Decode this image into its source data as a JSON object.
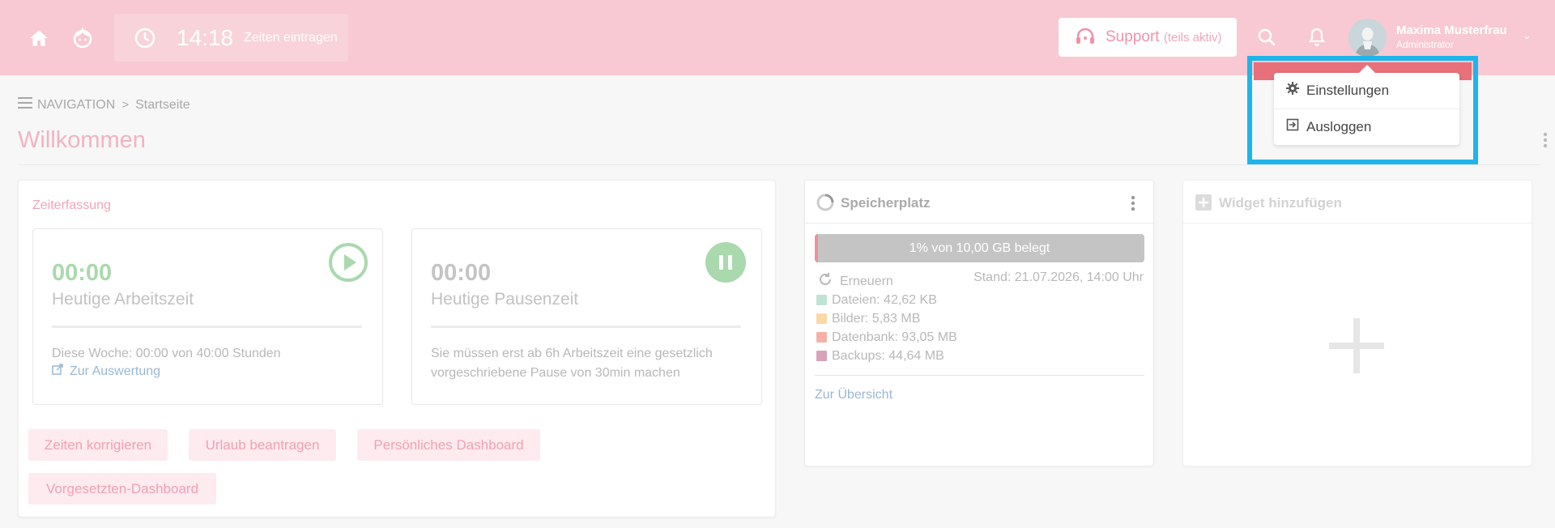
{
  "header": {
    "time": "14:18",
    "time_link": "Zeiten eintragen",
    "support_label": "Support",
    "support_sub": "(teils aktiv)",
    "user_name": "Maxima Musterfrau",
    "user_role": "Administrator",
    "bg_color": "#f8c9d2"
  },
  "breadcrumb": {
    "nav": "NAVIGATION",
    "separator": ">",
    "current": "Startseite"
  },
  "page_title": "Willkommen",
  "zeiterfassung": {
    "title": "Zeiterfassung",
    "work": {
      "time": "00:00",
      "label": "Heutige Arbeitszeit",
      "week_text": "Diese Woche: 00:00 von 40:00 Stunden",
      "link": "Zur Auswertung"
    },
    "pause": {
      "time": "00:00",
      "label": "Heutige Pausenzeit",
      "info": "Sie müssen erst ab 6h Arbeitszeit eine gesetzlich vorgeschriebene Pause von 30min machen"
    },
    "actions": [
      "Zeiten korrigieren",
      "Urlaub beantragen",
      "Persönliches Dashboard",
      "Vorgesetzten-Dashboard"
    ]
  },
  "speicher": {
    "title": "Speicherplatz",
    "usage_percent": 1,
    "usage_label": "1% von 10,00 GB belegt",
    "refresh": "Erneuern",
    "stand": "Stand: 21.07.2026, 14:00 Uhr",
    "legend": [
      {
        "label": "Dateien: 42,62 KB",
        "color": "#bfe3d5"
      },
      {
        "label": "Bilder: 5,83 MB",
        "color": "#fbd8a8"
      },
      {
        "label": "Datenbank: 93,05 MB",
        "color": "#f6b0a6"
      },
      {
        "label": "Backups: 44,64 MB",
        "color": "#d8a3b8"
      }
    ],
    "link": "Zur Übersicht"
  },
  "widget": {
    "title": "Widget hinzufügen"
  },
  "user_menu": {
    "items": [
      "Einstellungen",
      "Ausloggen"
    ],
    "highlight_color": "#1eb5ea"
  }
}
